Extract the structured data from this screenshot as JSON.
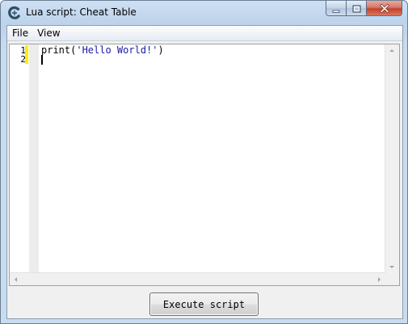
{
  "window": {
    "title": "Lua script: Cheat Table"
  },
  "menu": {
    "items": [
      {
        "label": "File"
      },
      {
        "label": "View"
      }
    ]
  },
  "editor": {
    "line_numbers": [
      "1",
      "2"
    ],
    "lines": [
      {
        "prefix": "print(",
        "string": "'Hello World!'",
        "suffix": ")"
      },
      {
        "prefix": "",
        "string": "",
        "suffix": ""
      }
    ],
    "colors": {
      "string": "#1a1aa6",
      "change_marker": "#ffee00"
    }
  },
  "footer": {
    "execute_label": "Execute script"
  },
  "icons": {
    "app": "cheat-engine-icon",
    "minimize": "minimize-icon",
    "maximize": "maximize-icon",
    "close": "close-icon"
  }
}
